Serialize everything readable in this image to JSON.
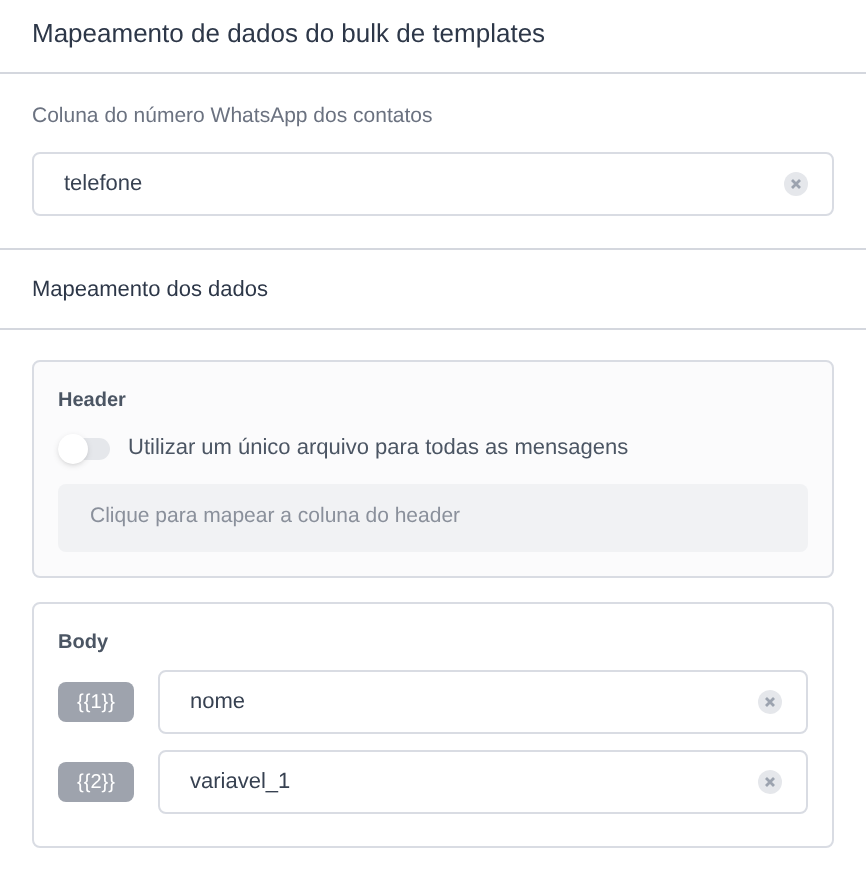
{
  "title": "Mapeamento de dados do bulk de templates",
  "phone_column": {
    "label": "Coluna do número WhatsApp dos contatos",
    "value": "telefone"
  },
  "mapping": {
    "title": "Mapeamento dos dados",
    "header": {
      "title": "Header",
      "toggle": {
        "label": "Utilizar um único arquivo para todas as mensagens",
        "on": false
      },
      "placeholder": "Clique para mapear a coluna do header"
    },
    "body": {
      "title": "Body",
      "variables": [
        {
          "tag": "{{1}}",
          "value": "nome"
        },
        {
          "tag": "{{2}}",
          "value": "variavel_1"
        }
      ]
    }
  }
}
